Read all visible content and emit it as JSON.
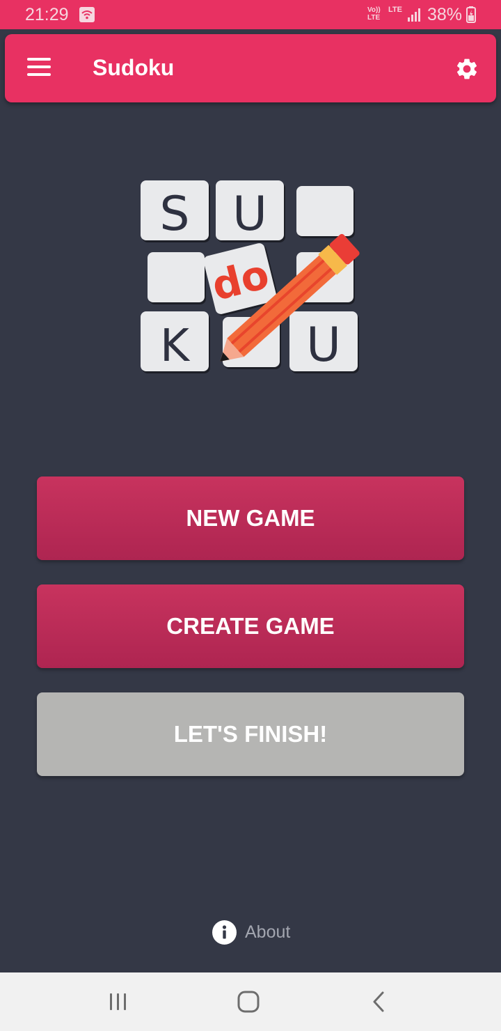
{
  "status_bar": {
    "time": "21:29",
    "volte_label": "Vo)) LTE",
    "lte_label": "LTE",
    "battery": "38%",
    "icons": [
      "wifi-icon",
      "signal-icon",
      "battery-icon"
    ]
  },
  "app_bar": {
    "title": "Sudoku",
    "menu_icon": "menu-icon",
    "settings_icon": "gear-icon"
  },
  "logo": {
    "tiles": [
      "S",
      "U",
      "",
      "",
      "do",
      "",
      "K",
      "",
      "U"
    ]
  },
  "buttons": {
    "new_game": "NEW GAME",
    "create_game": "CREATE GAME",
    "lets_finish": "LET'S FINISH!"
  },
  "about": {
    "label": "About",
    "icon": "info-icon"
  },
  "nav_bar": {
    "icons": [
      "recent-apps-icon",
      "home-icon",
      "back-icon"
    ]
  },
  "colors": {
    "accent": "#e83162",
    "background": "#343846",
    "button_pink": "#bb2d58",
    "button_grey": "#b5b5b3",
    "tile": "#e9eaec",
    "logo_red": "#e8402e"
  }
}
